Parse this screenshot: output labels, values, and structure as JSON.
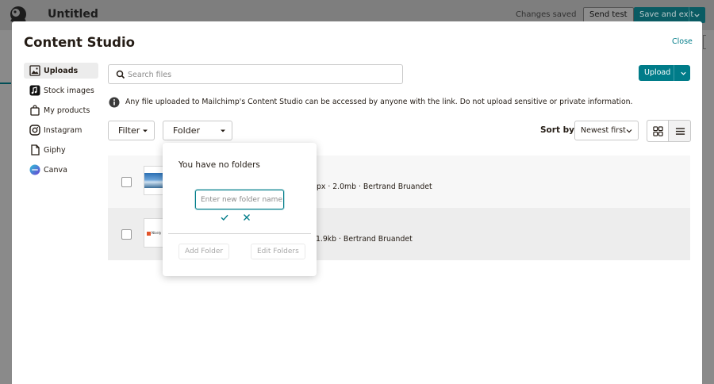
{
  "app": {
    "title": "Untitled",
    "status": "Changes saved",
    "send_test": "Send test",
    "save_and_exit": "Save and exit"
  },
  "modal": {
    "title": "Content Studio",
    "close": "Close"
  },
  "sidebar": {
    "items": [
      {
        "label": "Uploads",
        "icon": "image-icon",
        "active": true
      },
      {
        "label": "Stock images",
        "icon": "stock-images-icon",
        "active": false
      },
      {
        "label": "My products",
        "icon": "shopping-bag-icon",
        "active": false
      },
      {
        "label": "Instagram",
        "icon": "instagram-icon",
        "active": false
      },
      {
        "label": "Giphy",
        "icon": "giphy-icon",
        "active": false
      },
      {
        "label": "Canva",
        "icon": "canva-icon",
        "active": false
      }
    ]
  },
  "search": {
    "placeholder": "Search files"
  },
  "upload": {
    "label": "Upload"
  },
  "info": {
    "text": "Any file uploaded to Mailchimp's Content Studio can be accessed by anyone with the link. Do not upload sensitive or private information."
  },
  "filters": {
    "filter_label": "Filter",
    "folder_label": "Folder",
    "sort_by_label": "Sort by",
    "sort_value": "Newest first"
  },
  "files": [
    {
      "meta": "px · 2.0mb · Bertrand Bruandet",
      "thumb": "landscape"
    },
    {
      "meta": "1.9kb · Bertrand Bruandet",
      "thumb": "document",
      "thumb_text": "Nicely"
    }
  ],
  "folder_popover": {
    "empty_message": "You have no folders",
    "input_placeholder": "Enter new folder name",
    "add_folder": "Add Folder",
    "edit_folders": "Edit Folders"
  },
  "colors": {
    "accent": "#007c89",
    "dark_teal": "#0a5b63",
    "text": "#241c15"
  }
}
